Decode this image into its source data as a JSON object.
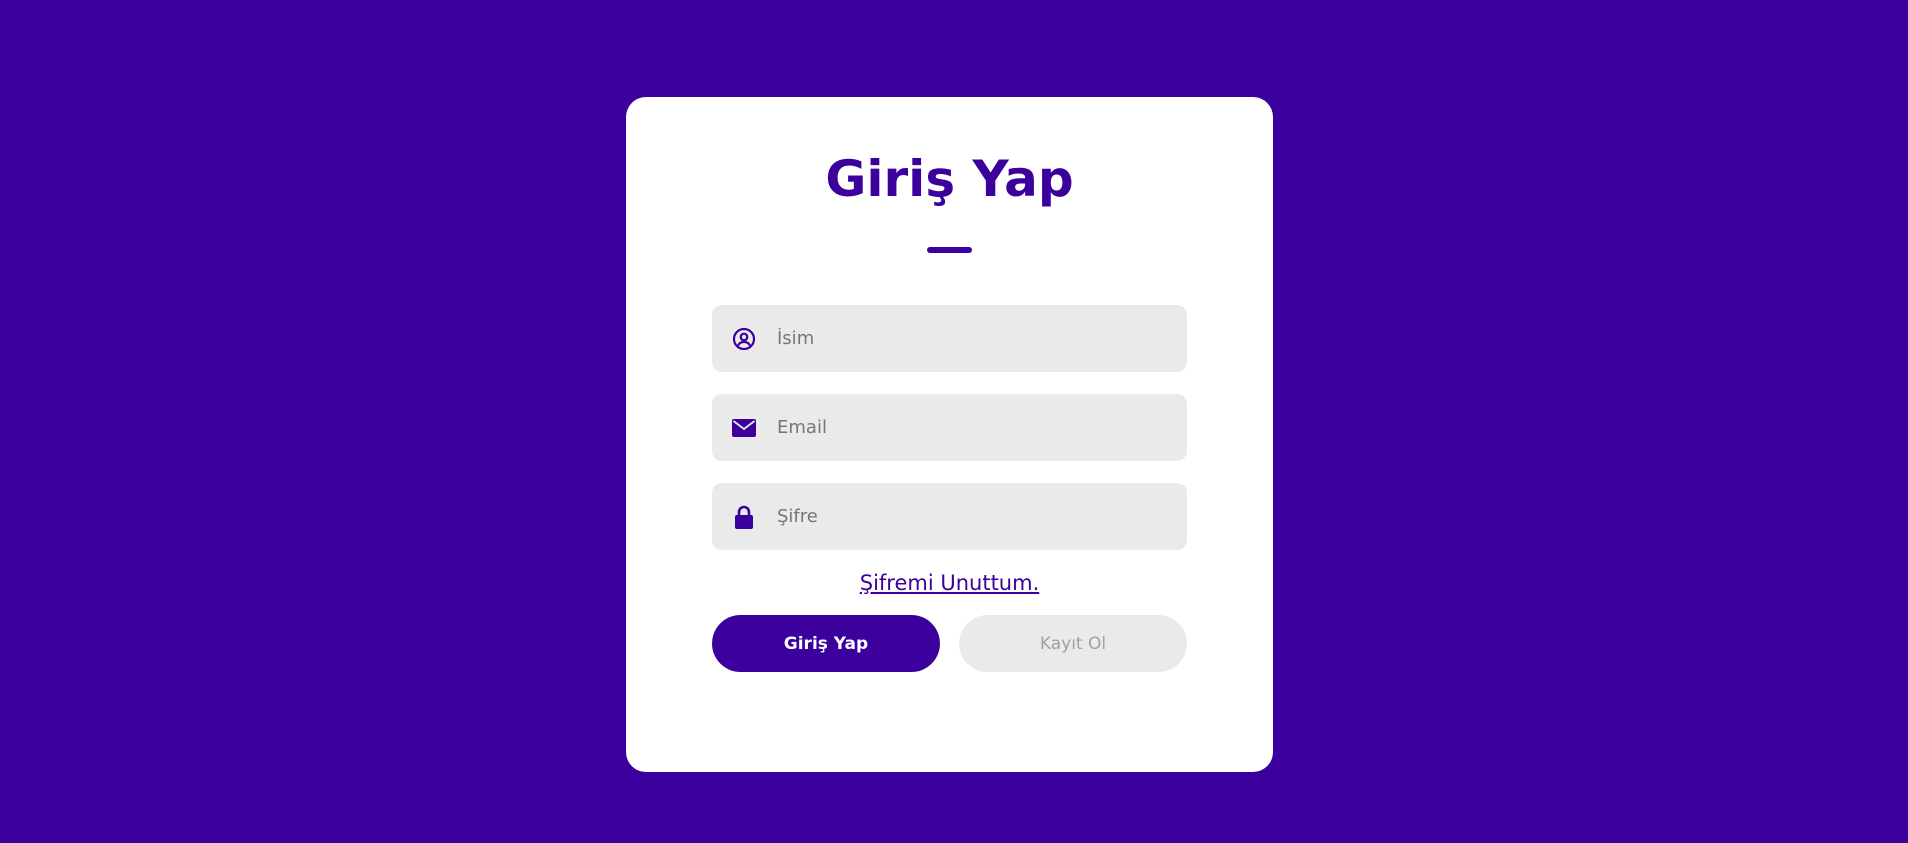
{
  "page": {
    "background_color": "#3c009d",
    "accent_color": "#3c009d"
  },
  "login": {
    "title": "Giriş Yap",
    "fields": [
      {
        "icon": "user-circle-icon",
        "placeholder": "İsim",
        "value": ""
      },
      {
        "icon": "envelope-icon",
        "placeholder": "Email",
        "value": ""
      },
      {
        "icon": "lock-icon",
        "placeholder": "Şifre",
        "value": ""
      }
    ],
    "forgot_password_link": "Şifremi Unuttum.",
    "login_button": "Giriş Yap",
    "register_button": "Kayıt Ol"
  }
}
